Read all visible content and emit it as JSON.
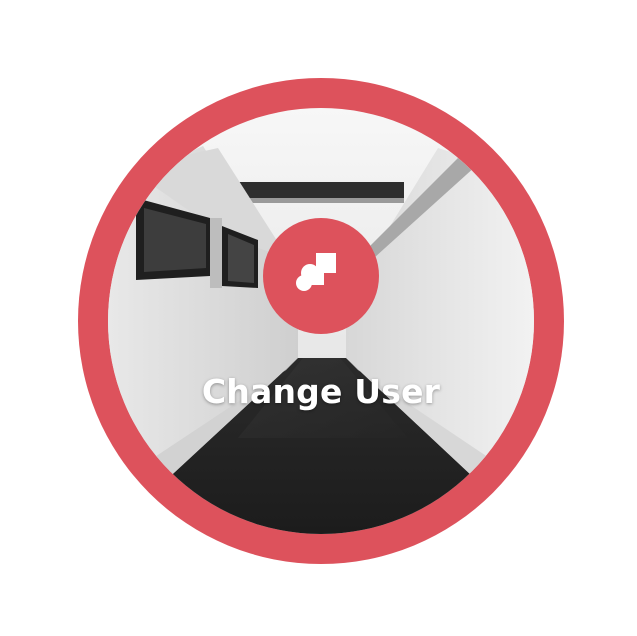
{
  "card": {
    "label": "Change User",
    "icon": "user-switch-icon",
    "background_image": "corridor-photo"
  },
  "colors": {
    "accent": "#dd525c",
    "text": "#ffffff"
  }
}
